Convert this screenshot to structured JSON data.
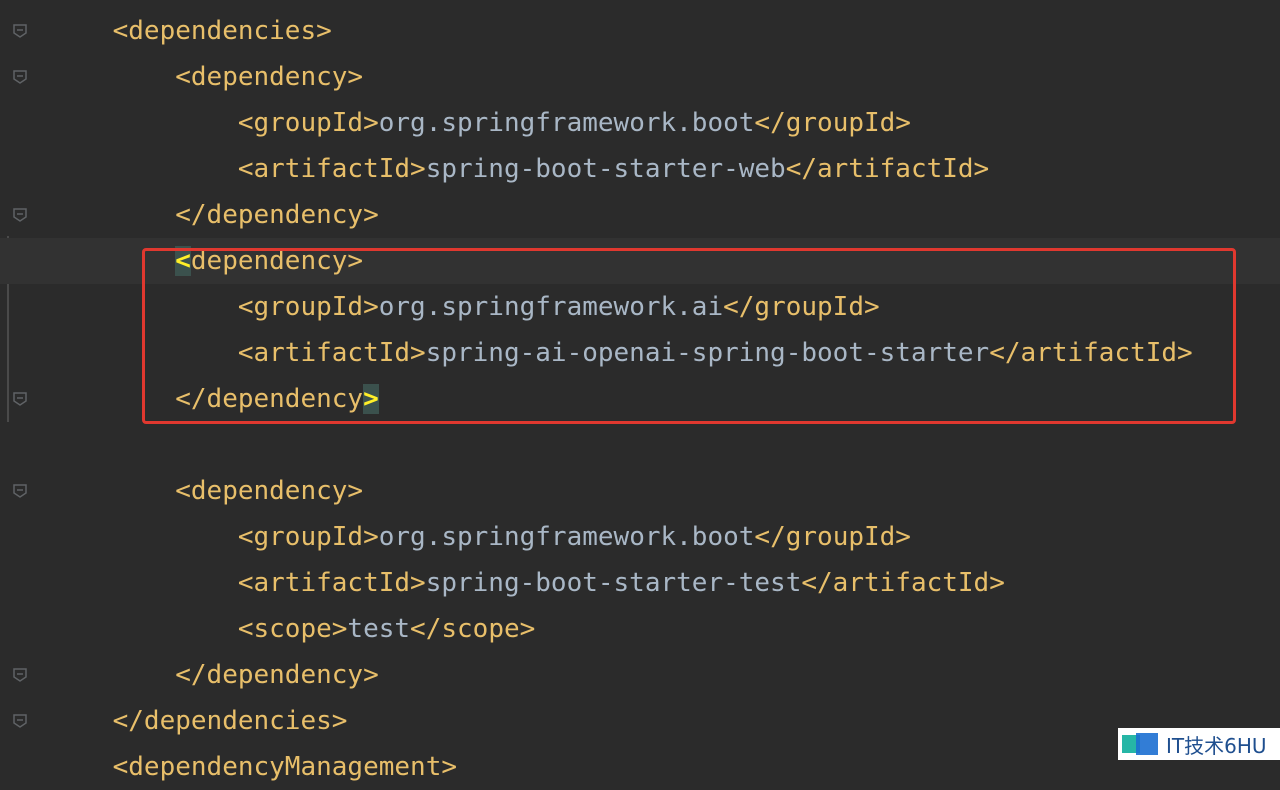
{
  "editor": {
    "lines": [
      {
        "indent": "    ",
        "tag_open": "<dependencies>",
        "text": "",
        "tag_close": ""
      },
      {
        "indent": "        ",
        "tag_open": "<dependency>",
        "text": "",
        "tag_close": ""
      },
      {
        "indent": "            ",
        "tag_open": "<groupId>",
        "text": "org.springframework.boot",
        "tag_close": "</groupId>"
      },
      {
        "indent": "            ",
        "tag_open": "<artifactId>",
        "text": "spring-boot-starter-web",
        "tag_close": "</artifactId>"
      },
      {
        "indent": "        ",
        "tag_open": "</dependency>",
        "text": "",
        "tag_close": ""
      },
      {
        "indent": "        ",
        "tag_open": "<dependency>",
        "text": "",
        "tag_close": ""
      },
      {
        "indent": "            ",
        "tag_open": "<groupId>",
        "text": "org.springframework.ai",
        "tag_close": "</groupId>"
      },
      {
        "indent": "            ",
        "tag_open": "<artifactId>",
        "text": "spring-ai-openai-spring-boot-starter",
        "tag_close": "</artifactId>"
      },
      {
        "indent": "        ",
        "tag_open": "</dependency>",
        "text": "",
        "tag_close": ""
      },
      {
        "indent": "",
        "tag_open": "",
        "text": "",
        "tag_close": ""
      },
      {
        "indent": "        ",
        "tag_open": "<dependency>",
        "text": "",
        "tag_close": ""
      },
      {
        "indent": "            ",
        "tag_open": "<groupId>",
        "text": "org.springframework.boot",
        "tag_close": "</groupId>"
      },
      {
        "indent": "            ",
        "tag_open": "<artifactId>",
        "text": "spring-boot-starter-test",
        "tag_close": "</artifactId>"
      },
      {
        "indent": "            ",
        "tag_open": "<scope>",
        "text": "test",
        "tag_close": "</scope>"
      },
      {
        "indent": "        ",
        "tag_open": "</dependency>",
        "text": "",
        "tag_close": ""
      },
      {
        "indent": "    ",
        "tag_open": "</dependencies>",
        "text": "",
        "tag_close": ""
      },
      {
        "indent": "    ",
        "tag_open": "<dependencyManagement>",
        "text": "",
        "tag_close": ""
      }
    ]
  },
  "watermark": {
    "text": "IT技术6HU"
  },
  "colors": {
    "tag": "#e8bf6a",
    "text": "#a9b7c6",
    "background": "#2b2b2b",
    "highlight_box": "#e0382f"
  }
}
